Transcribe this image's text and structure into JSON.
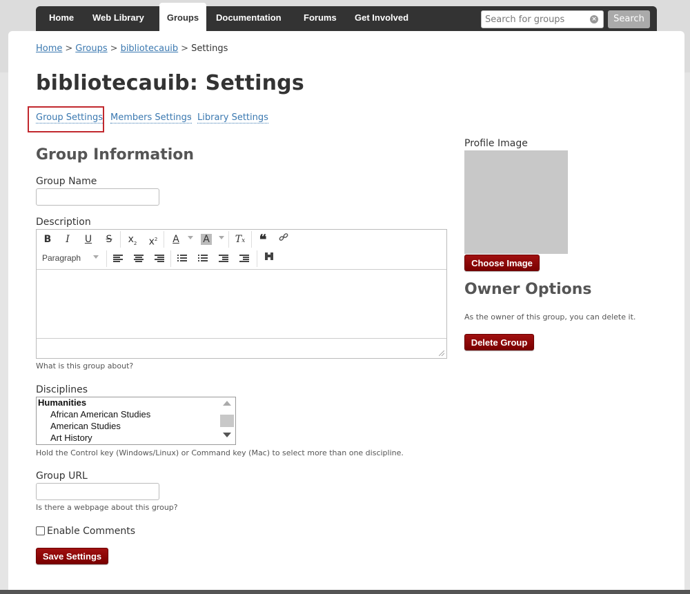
{
  "nav": {
    "items": [
      "Home",
      "Web Library",
      "Groups",
      "Documentation",
      "Forums",
      "Get Involved"
    ],
    "active": "Groups",
    "search_placeholder": "Search for groups",
    "search_button": "Search"
  },
  "breadcrumb": {
    "links": [
      "Home",
      "Groups",
      "bibliotecauib"
    ],
    "current": "Settings",
    "separator": ">"
  },
  "page_title": "bibliotecauib: Settings",
  "subnav": {
    "items": [
      "Group Settings",
      "Members Settings",
      "Library Settings"
    ],
    "separator": "·",
    "active": "Group Settings"
  },
  "group_info": {
    "heading": "Group Information",
    "group_name_label": "Group Name",
    "group_name_value": "",
    "description_label": "Description",
    "description_value": "",
    "description_help": "What is this group about?",
    "editor": {
      "format_select": "Paragraph",
      "buttons": [
        "bold",
        "italic",
        "underline",
        "strikethrough",
        "subscript",
        "superscript",
        "text-color",
        "background-color",
        "clear-formatting",
        "blockquote",
        "link",
        "align-left",
        "align-center",
        "align-right",
        "bullet-list",
        "numbered-list",
        "outdent",
        "indent",
        "find-replace"
      ]
    },
    "disciplines_label": "Disciplines",
    "disciplines": {
      "group": "Humanities",
      "options": [
        "African American Studies",
        "American Studies",
        "Art History"
      ]
    },
    "disciplines_help": "Hold the Control key (Windows/Linux) or Command key (Mac) to select more than one discipline.",
    "group_url_label": "Group URL",
    "group_url_value": "",
    "group_url_help": "Is there a webpage about this group?",
    "enable_comments_label": "Enable Comments",
    "enable_comments_checked": false,
    "save_button": "Save Settings"
  },
  "sidebar": {
    "profile_image_label": "Profile Image",
    "choose_image_button": "Choose Image",
    "owner_heading": "Owner Options",
    "owner_text": "As the owner of this group, you can delete it.",
    "delete_button": "Delete Group"
  },
  "colors": {
    "nav_bg": "#333333",
    "link": "#3a78b0",
    "button_red": "#8b0000",
    "highlight_border": "#c1272d"
  }
}
